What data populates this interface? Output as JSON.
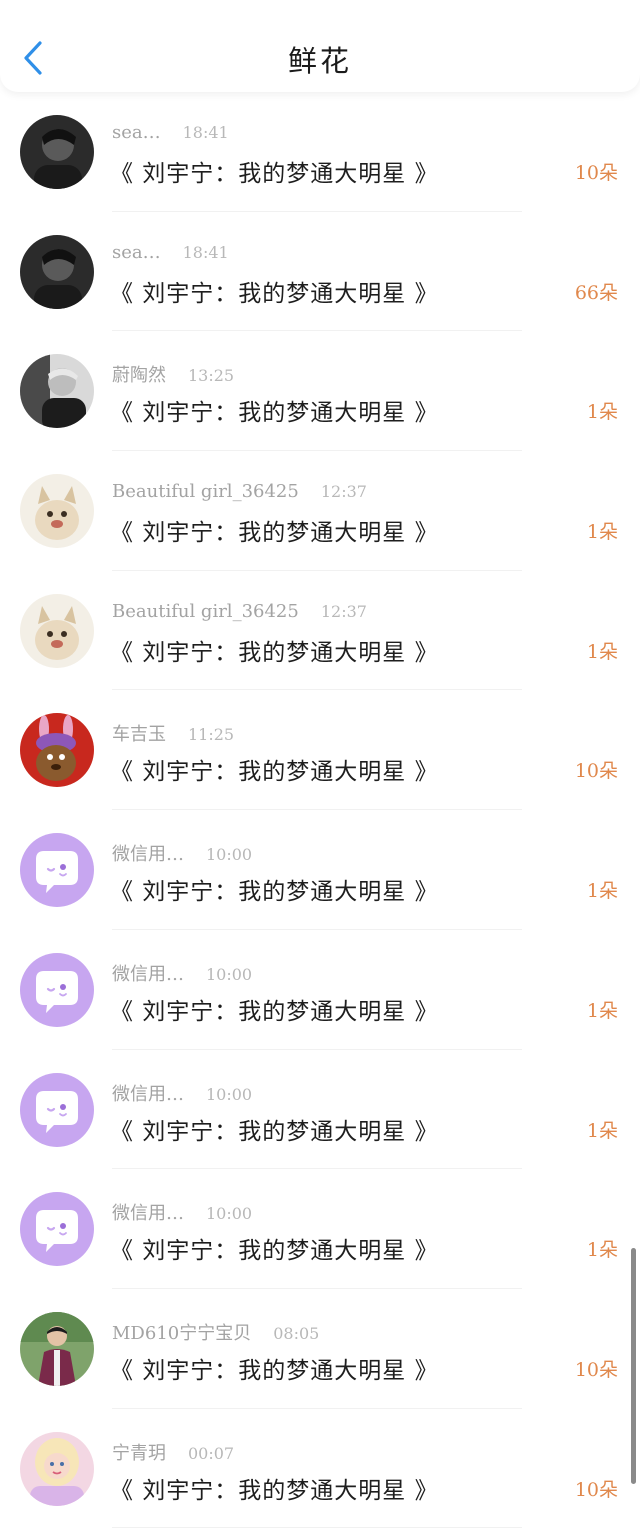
{
  "header": {
    "title": "鲜花"
  },
  "rows": [
    {
      "user": "sea…",
      "time": "18:41",
      "book": "《 刘宇宁：我的梦通大明星 》",
      "amount": "10朵",
      "avatar": "dark-portrait"
    },
    {
      "user": "sea…",
      "time": "18:41",
      "book": "《 刘宇宁：我的梦通大明星 》",
      "amount": "66朵",
      "avatar": "dark-portrait"
    },
    {
      "user": "蔚陶然",
      "time": "13:25",
      "book": "《 刘宇宁：我的梦通大明星 》",
      "amount": "1朵",
      "avatar": "bw-portrait"
    },
    {
      "user": "Beautiful girl_36425",
      "time": "12:37",
      "book": "《 刘宇宁：我的梦通大明星 》",
      "amount": "1朵",
      "avatar": "cat-cartoon"
    },
    {
      "user": "Beautiful girl_36425",
      "time": "12:37",
      "book": "《 刘宇宁：我的梦通大明星 》",
      "amount": "1朵",
      "avatar": "cat-cartoon"
    },
    {
      "user": "车吉玉",
      "time": "11:25",
      "book": "《 刘宇宁：我的梦通大明星 》",
      "amount": "10朵",
      "avatar": "bunny-cartoon"
    },
    {
      "user": "微信用…",
      "time": "10:00",
      "book": "《 刘宇宁：我的梦通大明星 》",
      "amount": "1朵",
      "avatar": "wechat-default"
    },
    {
      "user": "微信用…",
      "time": "10:00",
      "book": "《 刘宇宁：我的梦通大明星 》",
      "amount": "1朵",
      "avatar": "wechat-default"
    },
    {
      "user": "微信用…",
      "time": "10:00",
      "book": "《 刘宇宁：我的梦通大明星 》",
      "amount": "1朵",
      "avatar": "wechat-default"
    },
    {
      "user": "微信用…",
      "time": "10:00",
      "book": "《 刘宇宁：我的梦通大明星 》",
      "amount": "1朵",
      "avatar": "wechat-default"
    },
    {
      "user": "MD610宁宁宝贝",
      "time": "08:05",
      "book": "《 刘宇宁：我的梦通大明星 》",
      "amount": "10朵",
      "avatar": "man-suit-photo"
    },
    {
      "user": "宁青玥",
      "time": "00:07",
      "book": "《 刘宇宁：我的梦通大明星 》",
      "amount": "10朵",
      "avatar": "blonde-girl-photo"
    }
  ],
  "colors": {
    "accent_back": "#2f8fe8",
    "amount": "#e0884c",
    "wechat_avatar": "#c7a6f0"
  },
  "scroll": {
    "position_fraction": 0.84
  }
}
